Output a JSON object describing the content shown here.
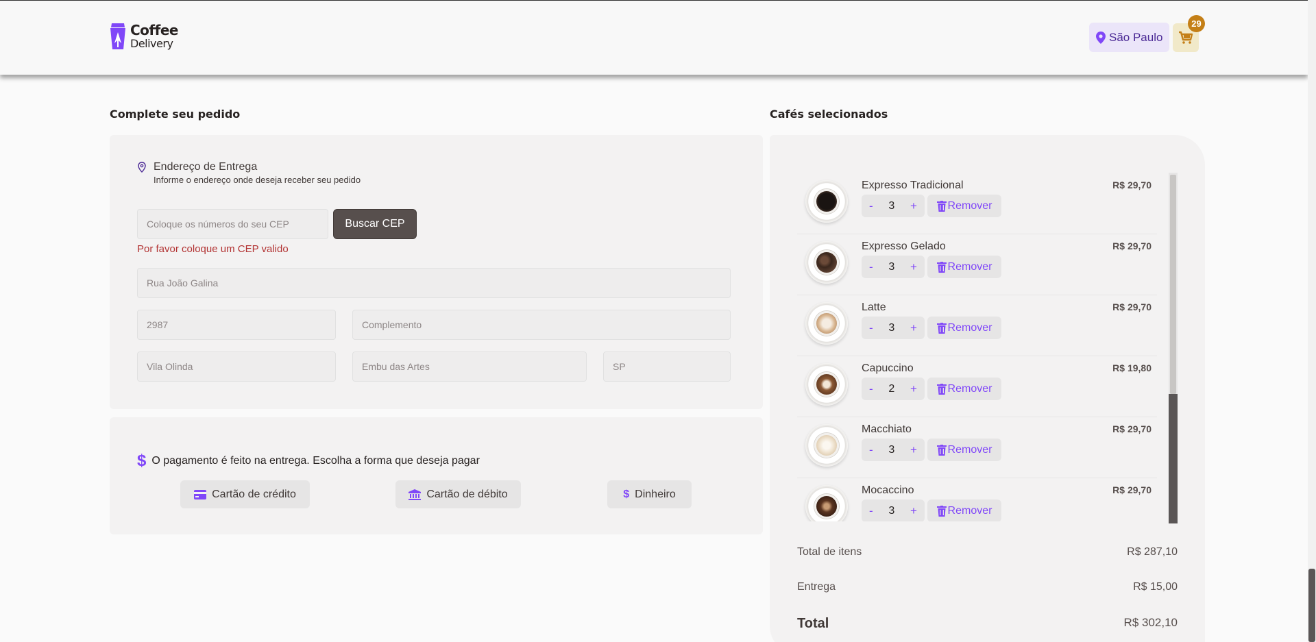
{
  "header": {
    "logo_line1": "Coffee",
    "logo_line2": "Delivery",
    "location": "São Paulo",
    "cart_count": "29"
  },
  "checkout": {
    "title": "Complete seu pedido",
    "address": {
      "heading": "Endereço de Entrega",
      "subheading": "Informe o endereço onde deseja receber seu pedido",
      "cep_placeholder": "Coloque os números do seu CEP",
      "cep_button": "Buscar CEP",
      "cep_error": "Por favor coloque um CEP valido",
      "street_placeholder": "Rua João Galina",
      "number_placeholder": "2987",
      "complement_placeholder": "Complemento",
      "district_placeholder": "Vila Olinda",
      "city_placeholder": "Embu das Artes",
      "uf_placeholder": "SP"
    },
    "payment": {
      "heading": "O pagamento é feito na entrega. Escolha a forma que deseja pagar",
      "credit": "Cartão de crédito",
      "debit": "Cartão de débito",
      "cash": "Dinheiro"
    }
  },
  "cart": {
    "title": "Cafés selecionados",
    "remove_label": "Remover",
    "items": [
      {
        "name": "Expresso Tradicional",
        "qty": "3",
        "price": "R$ 29,70"
      },
      {
        "name": "Expresso Gelado",
        "qty": "3",
        "price": "R$ 29,70"
      },
      {
        "name": "Latte",
        "qty": "3",
        "price": "R$ 29,70"
      },
      {
        "name": "Capuccino",
        "qty": "2",
        "price": "R$ 19,80"
      },
      {
        "name": "Macchiato",
        "qty": "3",
        "price": "R$ 29,70"
      },
      {
        "name": "Mocaccino",
        "qty": "3",
        "price": "R$ 29,70"
      }
    ],
    "totals": {
      "items_label": "Total de itens",
      "items_value": "R$ 287,10",
      "delivery_label": "Entrega",
      "delivery_value": "R$ 15,00",
      "total_label": "Total",
      "total_value": "R$ 302,10"
    }
  },
  "colors": {
    "purple": "#8047f8",
    "purple_dark": "#4b2995",
    "yellow_dark": "#c47f17",
    "error": "#b23232"
  }
}
